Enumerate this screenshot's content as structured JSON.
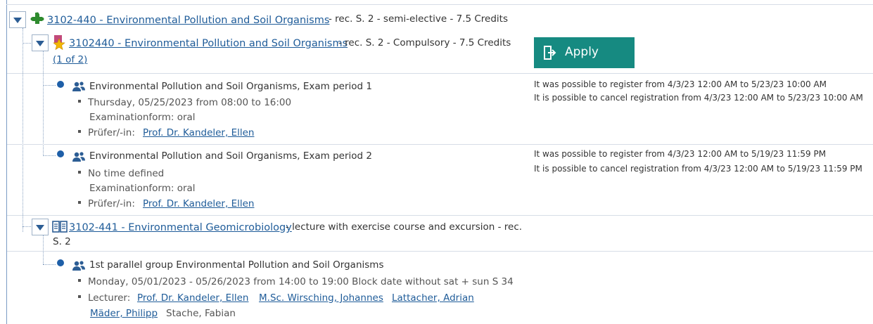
{
  "module": {
    "link": "3102-440 - Environmental Pollution and Soil Organisms",
    "meta": "- rec. S. 2 - semi-elective - 7.5 Credits"
  },
  "course": {
    "link": "3102440 - Environmental Pollution and Soil Organisms",
    "meta": "- rec. S. 2 - Compulsory - 7.5 Credits",
    "pager": "(1 of 2)",
    "apply_label": "Apply"
  },
  "exams": [
    {
      "title": "Environmental Pollution and Soil Organisms, Exam period 1",
      "time": "Thursday, 05/25/2023 from 08:00 to 16:00",
      "form": "Examinationform: oral",
      "examiner_label": "Prüfer/-in:",
      "examiner": "Prof. Dr. Kandeler, Ellen",
      "register": "It was possible to register from 4/3/23 12:00 AM to 5/23/23 10:00 AM",
      "cancel": "It is possible to cancel registration from 4/3/23 12:00 AM to 5/23/23 10:00 AM"
    },
    {
      "title": "Environmental Pollution and Soil Organisms, Exam period 2",
      "time": "No time defined",
      "form": "Examinationform: oral",
      "examiner_label": "Prüfer/-in:",
      "examiner": "Prof. Dr. Kandeler, Ellen",
      "register": "It was possible to register from 4/3/23 12:00 AM to 5/19/23 11:59 PM",
      "cancel": "It is possible to cancel registration from 4/3/23 12:00 AM to 5/19/23 11:59 PM"
    }
  ],
  "lecture": {
    "link": "3102-441 - Environmental Geomicrobiology",
    "meta": "- lecture with exercise course and excursion - rec.",
    "meta2": "S. 2"
  },
  "group": {
    "title": "1st parallel group Environmental Pollution and Soil Organisms",
    "time": "Monday, 05/01/2023 - 05/26/2023 from 14:00 to 19:00 Block date without sat + sun S 34",
    "lecturer_label": "Lecturer:",
    "lecturers": [
      "Prof. Dr. Kandeler, Ellen",
      "M.Sc. Wirsching, Johannes",
      "Lattacher, Adrian",
      "Mäder, Philipp"
    ],
    "lecturer_plain": "Stache, Fabian"
  },
  "colors": {
    "link": "#1f5c99",
    "apply": "#168a81",
    "bullet": "#1e5fa8",
    "puzzle": "#2e8b2e",
    "star": "#f2b705"
  }
}
